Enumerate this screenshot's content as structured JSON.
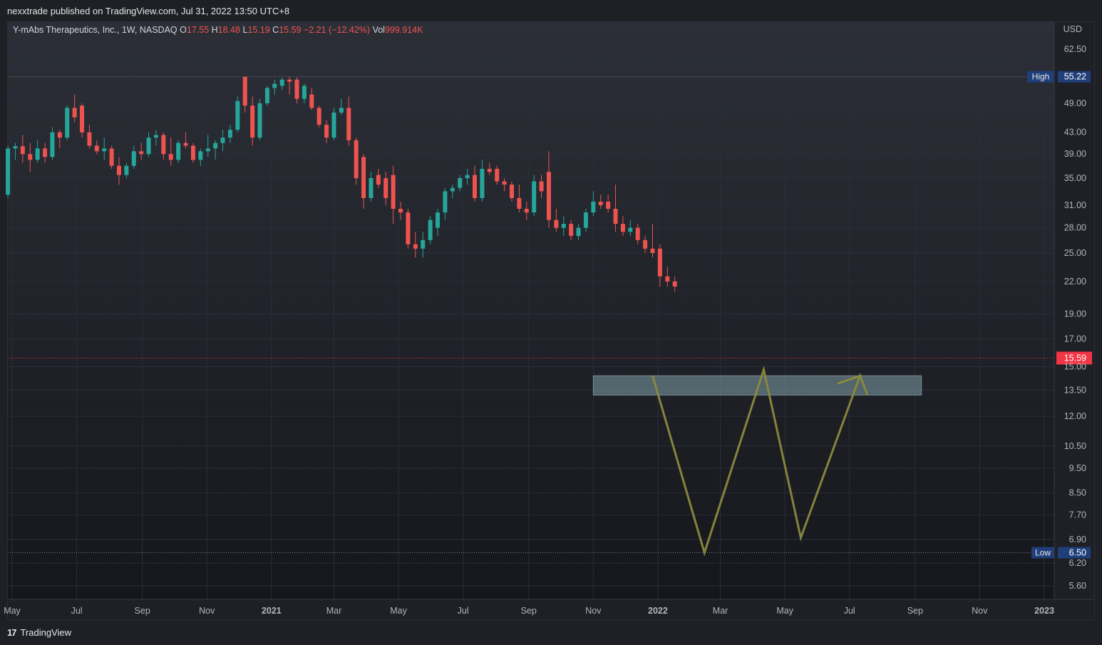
{
  "publisher_line": "nexxtrade published on TradingView.com, Jul 31, 2022 13:50 UTC+8",
  "footer": {
    "logo_text": "TradingView",
    "logo_mark": "17"
  },
  "legend": {
    "symbol": "Y-mAbs Therapeutics, Inc., 1W, NASDAQ",
    "o_label": "O",
    "o_value": "17.55",
    "h_label": "H",
    "h_value": "18.48",
    "l_label": "L",
    "l_value": "15.19",
    "c_label": "C",
    "c_value": "15.59",
    "change": "−2.21 (−12.42%)",
    "vol_label": "Vol",
    "vol_value": "999.914K"
  },
  "colors": {
    "up": "#26a69a",
    "down": "#ef5350",
    "background_top": "#2c2f37",
    "background_bottom": "#15171c",
    "grid": "#2a2e39",
    "pattern": "#8c8a3c",
    "zone": "#7f9fa8",
    "price_label_bg": "#1f3e7a",
    "last_price_bg": "#f23645"
  },
  "chart_data": {
    "type": "candlestick",
    "title": "Y-mAbs Therapeutics, Inc., 1W, NASDAQ",
    "interval": "1W",
    "currency": "USD",
    "y_scale": "log",
    "y_ticks": [
      "62.50",
      "49.00",
      "43.00",
      "39.00",
      "35.00",
      "31.00",
      "28.00",
      "25.00",
      "22.00",
      "19.00",
      "17.00",
      "15.00",
      "13.50",
      "12.00",
      "10.50",
      "9.50",
      "8.50",
      "7.70",
      "6.90",
      "6.20",
      "5.60"
    ],
    "x_ticks": [
      {
        "label": "May",
        "date": "2020-05-01"
      },
      {
        "label": "Jul",
        "date": "2020-07-01"
      },
      {
        "label": "Sep",
        "date": "2020-09-01"
      },
      {
        "label": "Nov",
        "date": "2020-11-01"
      },
      {
        "label": "2021",
        "date": "2021-01-01",
        "bold": true
      },
      {
        "label": "Mar",
        "date": "2021-03-01"
      },
      {
        "label": "May",
        "date": "2021-05-01"
      },
      {
        "label": "Jul",
        "date": "2021-07-01"
      },
      {
        "label": "Sep",
        "date": "2021-09-01"
      },
      {
        "label": "Nov",
        "date": "2021-11-01"
      },
      {
        "label": "2022",
        "date": "2022-01-01",
        "bold": true
      },
      {
        "label": "Mar",
        "date": "2022-03-01"
      },
      {
        "label": "May",
        "date": "2022-05-01"
      },
      {
        "label": "Jul",
        "date": "2022-07-01"
      },
      {
        "label": "Sep",
        "date": "2022-09-01"
      },
      {
        "label": "Nov",
        "date": "2022-11-01"
      },
      {
        "label": "2023",
        "date": "2023-01-01",
        "bold": true
      }
    ],
    "high": {
      "label": "High",
      "value": "55.22"
    },
    "low": {
      "label": "Low",
      "value": "6.50"
    },
    "last_price": "15.59",
    "zone": {
      "start": "2021-11-01",
      "end": "2022-09-07",
      "low": 13.2,
      "high": 14.4
    },
    "pattern_line": [
      {
        "date": "2021-12-27",
        "price": 14.4
      },
      {
        "date": "2022-02-14",
        "price": 6.5
      },
      {
        "date": "2022-04-11",
        "price": 14.8
      },
      {
        "date": "2022-05-16",
        "price": 6.95
      },
      {
        "date": "2022-07-11",
        "price": 14.4
      },
      {
        "date": "2022-07-18",
        "price": 13.2
      }
    ],
    "pattern_arrow": [
      {
        "date": "2022-06-20",
        "price": 13.9
      },
      {
        "date": "2022-07-11",
        "price": 14.4
      }
    ],
    "candles": [
      {
        "date": "2020-04-27",
        "o": 32.5,
        "h": 40.5,
        "l": 32.0,
        "c": 40.0
      },
      {
        "date": "2020-05-04",
        "o": 40.0,
        "h": 41.0,
        "l": 38.0,
        "c": 40.4
      },
      {
        "date": "2020-05-11",
        "o": 40.4,
        "h": 42.5,
        "l": 37.5,
        "c": 39.0
      },
      {
        "date": "2020-05-18",
        "o": 39.0,
        "h": 41.0,
        "l": 36.0,
        "c": 38.0
      },
      {
        "date": "2020-05-25",
        "o": 38.0,
        "h": 41.5,
        "l": 37.5,
        "c": 40.0
      },
      {
        "date": "2020-06-01",
        "o": 40.0,
        "h": 41.0,
        "l": 37.5,
        "c": 38.5
      },
      {
        "date": "2020-06-08",
        "o": 38.5,
        "h": 44.0,
        "l": 38.0,
        "c": 43.0
      },
      {
        "date": "2020-06-15",
        "o": 43.0,
        "h": 43.5,
        "l": 40.0,
        "c": 42.0
      },
      {
        "date": "2020-06-22",
        "o": 42.0,
        "h": 48.5,
        "l": 41.5,
        "c": 48.0
      },
      {
        "date": "2020-06-29",
        "o": 48.0,
        "h": 51.0,
        "l": 45.0,
        "c": 46.0
      },
      {
        "date": "2020-07-06",
        "o": 48.5,
        "h": 49.0,
        "l": 42.0,
        "c": 43.0
      },
      {
        "date": "2020-07-13",
        "o": 43.0,
        "h": 44.5,
        "l": 40.0,
        "c": 40.5
      },
      {
        "date": "2020-07-20",
        "o": 40.5,
        "h": 41.5,
        "l": 39.0,
        "c": 39.5
      },
      {
        "date": "2020-07-27",
        "o": 39.5,
        "h": 42.0,
        "l": 38.0,
        "c": 40.0
      },
      {
        "date": "2020-08-03",
        "o": 40.0,
        "h": 40.5,
        "l": 36.5,
        "c": 37.0
      },
      {
        "date": "2020-08-10",
        "o": 37.0,
        "h": 38.5,
        "l": 34.0,
        "c": 35.5
      },
      {
        "date": "2020-08-17",
        "o": 35.5,
        "h": 37.5,
        "l": 35.0,
        "c": 37.0
      },
      {
        "date": "2020-08-24",
        "o": 37.0,
        "h": 40.5,
        "l": 36.5,
        "c": 39.5
      },
      {
        "date": "2020-08-31",
        "o": 39.5,
        "h": 41.0,
        "l": 38.0,
        "c": 39.0
      },
      {
        "date": "2020-09-07",
        "o": 39.0,
        "h": 43.0,
        "l": 38.5,
        "c": 42.0
      },
      {
        "date": "2020-09-14",
        "o": 42.0,
        "h": 43.5,
        "l": 40.5,
        "c": 42.5
      },
      {
        "date": "2020-09-21",
        "o": 42.5,
        "h": 43.0,
        "l": 38.0,
        "c": 39.0
      },
      {
        "date": "2020-09-28",
        "o": 39.0,
        "h": 42.0,
        "l": 37.0,
        "c": 38.0
      },
      {
        "date": "2020-10-05",
        "o": 38.0,
        "h": 41.5,
        "l": 37.5,
        "c": 41.0
      },
      {
        "date": "2020-10-12",
        "o": 41.0,
        "h": 43.0,
        "l": 40.0,
        "c": 40.5
      },
      {
        "date": "2020-10-19",
        "o": 40.5,
        "h": 41.0,
        "l": 37.5,
        "c": 38.0
      },
      {
        "date": "2020-10-26",
        "o": 38.0,
        "h": 40.0,
        "l": 37.0,
        "c": 39.5
      },
      {
        "date": "2020-11-02",
        "o": 39.5,
        "h": 42.5,
        "l": 38.5,
        "c": 40.0
      },
      {
        "date": "2020-11-09",
        "o": 40.0,
        "h": 41.5,
        "l": 38.0,
        "c": 41.0
      },
      {
        "date": "2020-11-16",
        "o": 41.0,
        "h": 43.5,
        "l": 39.5,
        "c": 42.0
      },
      {
        "date": "2020-11-23",
        "o": 42.0,
        "h": 44.5,
        "l": 41.0,
        "c": 43.5
      },
      {
        "date": "2020-11-30",
        "o": 43.5,
        "h": 50.5,
        "l": 43.0,
        "c": 49.5
      },
      {
        "date": "2020-12-07",
        "o": 55.2,
        "h": 55.2,
        "l": 47.0,
        "c": 48.5
      },
      {
        "date": "2020-12-14",
        "o": 48.5,
        "h": 50.5,
        "l": 40.5,
        "c": 42.0
      },
      {
        "date": "2020-12-21",
        "o": 42.0,
        "h": 50.0,
        "l": 41.5,
        "c": 49.0
      },
      {
        "date": "2020-12-28",
        "o": 49.0,
        "h": 53.0,
        "l": 48.5,
        "c": 52.5
      },
      {
        "date": "2021-01-04",
        "o": 52.5,
        "h": 54.5,
        "l": 51.0,
        "c": 53.5
      },
      {
        "date": "2021-01-11",
        "o": 53.0,
        "h": 55.0,
        "l": 52.0,
        "c": 54.5
      },
      {
        "date": "2021-01-18",
        "o": 54.5,
        "h": 55.2,
        "l": 51.0,
        "c": 54.0
      },
      {
        "date": "2021-01-25",
        "o": 54.5,
        "h": 55.0,
        "l": 49.0,
        "c": 50.0
      },
      {
        "date": "2021-02-01",
        "o": 50.0,
        "h": 53.5,
        "l": 49.0,
        "c": 53.0
      },
      {
        "date": "2021-02-08",
        "o": 51.0,
        "h": 52.5,
        "l": 47.5,
        "c": 48.0
      },
      {
        "date": "2021-02-15",
        "o": 48.0,
        "h": 48.5,
        "l": 44.0,
        "c": 44.5
      },
      {
        "date": "2021-02-22",
        "o": 44.5,
        "h": 45.5,
        "l": 41.0,
        "c": 42.0
      },
      {
        "date": "2021-03-01",
        "o": 42.0,
        "h": 48.0,
        "l": 41.5,
        "c": 47.0
      },
      {
        "date": "2021-03-08",
        "o": 47.0,
        "h": 50.0,
        "l": 46.5,
        "c": 48.0
      },
      {
        "date": "2021-03-15",
        "o": 48.0,
        "h": 50.5,
        "l": 40.5,
        "c": 41.5
      },
      {
        "date": "2021-03-22",
        "o": 41.5,
        "h": 42.0,
        "l": 34.0,
        "c": 35.0
      },
      {
        "date": "2021-03-29",
        "o": 38.5,
        "h": 39.0,
        "l": 30.5,
        "c": 32.0
      },
      {
        "date": "2021-04-05",
        "o": 32.0,
        "h": 36.0,
        "l": 31.5,
        "c": 35.0
      },
      {
        "date": "2021-04-12",
        "o": 35.5,
        "h": 36.5,
        "l": 33.5,
        "c": 34.0
      },
      {
        "date": "2021-04-19",
        "o": 35.0,
        "h": 36.0,
        "l": 31.0,
        "c": 32.0
      },
      {
        "date": "2021-04-26",
        "o": 35.5,
        "h": 37.0,
        "l": 28.5,
        "c": 30.5
      },
      {
        "date": "2021-05-03",
        "o": 30.5,
        "h": 31.5,
        "l": 29.0,
        "c": 30.0
      },
      {
        "date": "2021-05-10",
        "o": 30.0,
        "h": 30.5,
        "l": 25.5,
        "c": 26.0
      },
      {
        "date": "2021-05-17",
        "o": 26.0,
        "h": 27.5,
        "l": 24.5,
        "c": 25.5
      },
      {
        "date": "2021-05-24",
        "o": 25.5,
        "h": 27.5,
        "l": 24.5,
        "c": 26.5
      },
      {
        "date": "2021-05-31",
        "o": 26.5,
        "h": 29.5,
        "l": 26.0,
        "c": 29.0
      },
      {
        "date": "2021-06-07",
        "o": 28.0,
        "h": 30.5,
        "l": 27.0,
        "c": 30.0
      },
      {
        "date": "2021-06-14",
        "o": 30.0,
        "h": 33.5,
        "l": 29.0,
        "c": 33.0
      },
      {
        "date": "2021-06-21",
        "o": 33.0,
        "h": 34.0,
        "l": 32.0,
        "c": 33.5
      },
      {
        "date": "2021-06-28",
        "o": 33.5,
        "h": 35.5,
        "l": 33.0,
        "c": 35.0
      },
      {
        "date": "2021-07-05",
        "o": 35.0,
        "h": 36.5,
        "l": 34.0,
        "c": 35.5
      },
      {
        "date": "2021-07-12",
        "o": 35.5,
        "h": 37.0,
        "l": 31.5,
        "c": 32.0
      },
      {
        "date": "2021-07-19",
        "o": 32.0,
        "h": 38.0,
        "l": 31.5,
        "c": 36.5
      },
      {
        "date": "2021-07-26",
        "o": 36.5,
        "h": 37.5,
        "l": 35.5,
        "c": 36.0
      },
      {
        "date": "2021-08-02",
        "o": 36.5,
        "h": 37.0,
        "l": 34.0,
        "c": 34.5
      },
      {
        "date": "2021-08-09",
        "o": 34.5,
        "h": 35.0,
        "l": 33.0,
        "c": 34.0
      },
      {
        "date": "2021-08-16",
        "o": 34.0,
        "h": 34.5,
        "l": 31.5,
        "c": 32.0
      },
      {
        "date": "2021-08-23",
        "o": 32.0,
        "h": 34.0,
        "l": 30.0,
        "c": 30.5
      },
      {
        "date": "2021-08-30",
        "o": 30.5,
        "h": 31.5,
        "l": 29.0,
        "c": 30.0
      },
      {
        "date": "2021-09-06",
        "o": 30.0,
        "h": 35.5,
        "l": 29.5,
        "c": 34.5
      },
      {
        "date": "2021-09-13",
        "o": 34.5,
        "h": 35.5,
        "l": 32.0,
        "c": 33.0
      },
      {
        "date": "2021-09-20",
        "o": 36.0,
        "h": 39.5,
        "l": 28.0,
        "c": 29.0
      },
      {
        "date": "2021-09-27",
        "o": 29.0,
        "h": 30.5,
        "l": 27.5,
        "c": 28.0
      },
      {
        "date": "2021-10-04",
        "o": 28.0,
        "h": 29.5,
        "l": 27.0,
        "c": 28.5
      },
      {
        "date": "2021-10-11",
        "o": 28.5,
        "h": 29.0,
        "l": 26.5,
        "c": 27.0
      },
      {
        "date": "2021-10-18",
        "o": 27.0,
        "h": 28.5,
        "l": 26.5,
        "c": 28.0
      },
      {
        "date": "2021-10-25",
        "o": 28.0,
        "h": 30.5,
        "l": 27.5,
        "c": 30.0
      },
      {
        "date": "2021-11-01",
        "o": 30.0,
        "h": 33.0,
        "l": 29.5,
        "c": 31.5
      },
      {
        "date": "2021-11-08",
        "o": 31.5,
        "h": 32.5,
        "l": 30.5,
        "c": 31.0
      },
      {
        "date": "2021-11-15",
        "o": 31.5,
        "h": 32.5,
        "l": 30.0,
        "c": 30.5
      },
      {
        "date": "2021-11-22",
        "o": 30.5,
        "h": 34.0,
        "l": 27.5,
        "c": 28.5
      },
      {
        "date": "2021-11-29",
        "o": 28.5,
        "h": 29.5,
        "l": 27.0,
        "c": 27.5
      },
      {
        "date": "2021-12-06",
        "o": 27.5,
        "h": 29.0,
        "l": 27.0,
        "c": 28.0
      },
      {
        "date": "2021-12-13",
        "o": 28.0,
        "h": 28.5,
        "l": 26.0,
        "c": 26.5
      },
      {
        "date": "2021-12-20",
        "o": 26.5,
        "h": 27.0,
        "l": 25.0,
        "c": 25.5
      },
      {
        "date": "2021-12-27",
        "o": 25.5,
        "h": 28.5,
        "l": 24.5,
        "c": 25.0
      },
      {
        "date": "2022-01-03",
        "o": 25.5,
        "h": 26.0,
        "l": 21.5,
        "c": 22.5
      },
      {
        "date": "2022-01-10",
        "o": 22.5,
        "h": 23.5,
        "l": 21.5,
        "c": 22.0
      },
      {
        "date": "2022-01-17",
        "o": 22.0,
        "h": 22.5,
        "l": 21.0,
        "c": 21.5
      }
    ]
  }
}
